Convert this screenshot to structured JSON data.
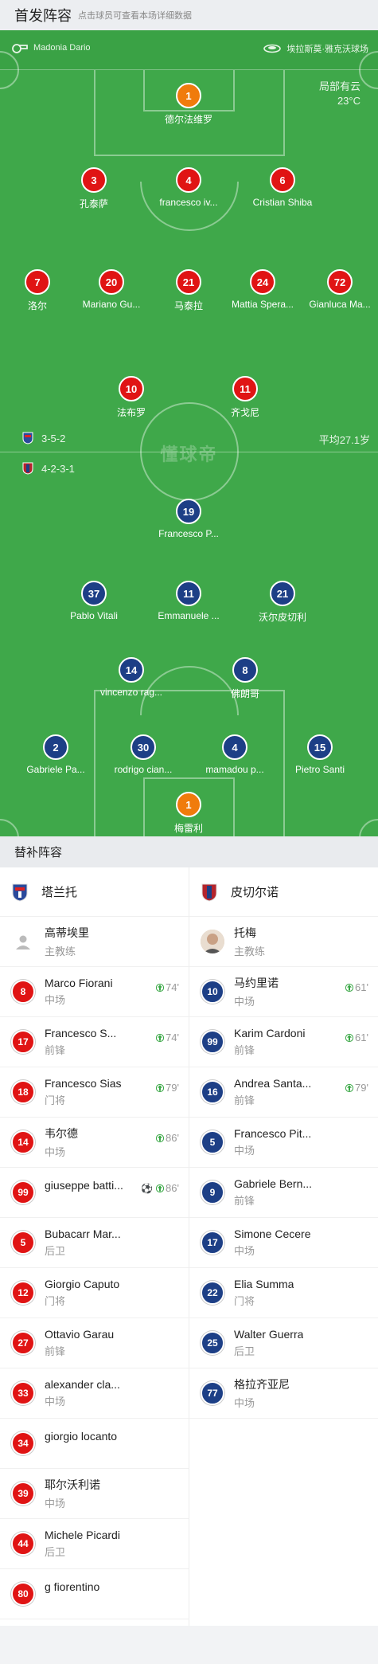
{
  "header": {
    "title": "首发阵容",
    "hint": "点击球员可查看本场详细数据"
  },
  "pitch": {
    "referee": "Madonia Dario",
    "stadium": "埃拉斯莫·雅克沃球场",
    "weather": "局部有云",
    "temperature": "23°C",
    "watermark": "懂球帝",
    "home_formation": "3-5-2",
    "away_formation": "4-2-3-1",
    "avg_age": "平均27.1岁"
  },
  "home_players": [
    {
      "num": "1",
      "name": "德尔法维罗",
      "color": "orange"
    },
    {
      "num": "3",
      "name": "孔泰萨",
      "yellow": true
    },
    {
      "num": "4",
      "name": "francesco iv..."
    },
    {
      "num": "6",
      "name": "Cristian Shiba"
    },
    {
      "num": "7",
      "name": "洛尔",
      "sub": "74'"
    },
    {
      "num": "20",
      "name": "Mariano Gu...",
      "sub": "74'"
    },
    {
      "num": "21",
      "name": "马泰拉",
      "sub": "79'"
    },
    {
      "num": "24",
      "name": "Mattia Spera...",
      "sub": "86'"
    },
    {
      "num": "72",
      "name": "Gianluca Ma...",
      "yellow": true
    },
    {
      "num": "10",
      "name": "法布罗"
    },
    {
      "num": "11",
      "name": "齐戈尼",
      "sub": "86'"
    }
  ],
  "away_players": [
    {
      "num": "19",
      "name": "Francesco P...",
      "yellow": true,
      "sub": "79'"
    },
    {
      "num": "37",
      "name": "Pablo Vitali",
      "sub": "61'"
    },
    {
      "num": "11",
      "name": "Emmanuele ...",
      "yellow": true,
      "sub": "61'"
    },
    {
      "num": "21",
      "name": "沃尔皮切利"
    },
    {
      "num": "14",
      "name": "vincenzo rag..."
    },
    {
      "num": "8",
      "name": "佛朗哥"
    },
    {
      "num": "2",
      "name": "Gabriele Pa..."
    },
    {
      "num": "30",
      "name": "rodrigo cian..."
    },
    {
      "num": "4",
      "name": "mamadou p..."
    },
    {
      "num": "15",
      "name": "Pietro Santi"
    },
    {
      "num": "1",
      "name": "梅雷利",
      "color": "orange"
    }
  ],
  "subs_section": {
    "title": "替补阵容"
  },
  "home_subs": {
    "team": "塔兰托",
    "coach": {
      "name": "高蒂埃里",
      "role": "主教练"
    },
    "players": [
      {
        "num": "8",
        "name": "Marco Fiorani",
        "pos": "中场",
        "time": "74'"
      },
      {
        "num": "17",
        "name": "Francesco S...",
        "pos": "前锋",
        "time": "74'"
      },
      {
        "num": "18",
        "name": "Francesco Sias",
        "pos": "门将",
        "time": "79'"
      },
      {
        "num": "14",
        "name": "韦尔德",
        "pos": "中场",
        "time": "86'"
      },
      {
        "num": "99",
        "name": "giuseppe batti...",
        "pos": "",
        "time": "86'",
        "goal": true
      },
      {
        "num": "5",
        "name": "Bubacarr Mar...",
        "pos": "后卫"
      },
      {
        "num": "12",
        "name": "Giorgio Caputo",
        "pos": "门将"
      },
      {
        "num": "27",
        "name": "Ottavio Garau",
        "pos": "前锋"
      },
      {
        "num": "33",
        "name": "alexander cla...",
        "pos": "中场"
      },
      {
        "num": "34",
        "name": "giorgio locanto",
        "pos": ""
      },
      {
        "num": "39",
        "name": "耶尔沃利诺",
        "pos": "中场"
      },
      {
        "num": "44",
        "name": "Michele Picardi",
        "pos": "后卫"
      },
      {
        "num": "80",
        "name": "g fiorentino",
        "pos": ""
      }
    ]
  },
  "away_subs": {
    "team": "皮切尔诺",
    "coach": {
      "name": "托梅",
      "role": "主教练"
    },
    "players": [
      {
        "num": "10",
        "name": "马约里诺",
        "pos": "中场",
        "time": "61'"
      },
      {
        "num": "99",
        "name": "Karim Cardoni",
        "pos": "前锋",
        "time": "61'"
      },
      {
        "num": "16",
        "name": "Andrea Santa...",
        "pos": "前锋",
        "time": "79'"
      },
      {
        "num": "5",
        "name": "Francesco Pit...",
        "pos": "中场"
      },
      {
        "num": "9",
        "name": "Gabriele Bern...",
        "pos": "前锋"
      },
      {
        "num": "17",
        "name": "Simone Cecere",
        "pos": "中场"
      },
      {
        "num": "22",
        "name": "Elia Summa",
        "pos": "门将"
      },
      {
        "num": "25",
        "name": "Walter Guerra",
        "pos": "后卫"
      },
      {
        "num": "77",
        "name": "格拉齐亚尼",
        "pos": "中场"
      }
    ]
  },
  "colors": {
    "pitch": "#3fa84a",
    "home": "#e01414",
    "away": "#1d3f86",
    "keeper": "#f07b0c",
    "card": "#f5c518"
  }
}
